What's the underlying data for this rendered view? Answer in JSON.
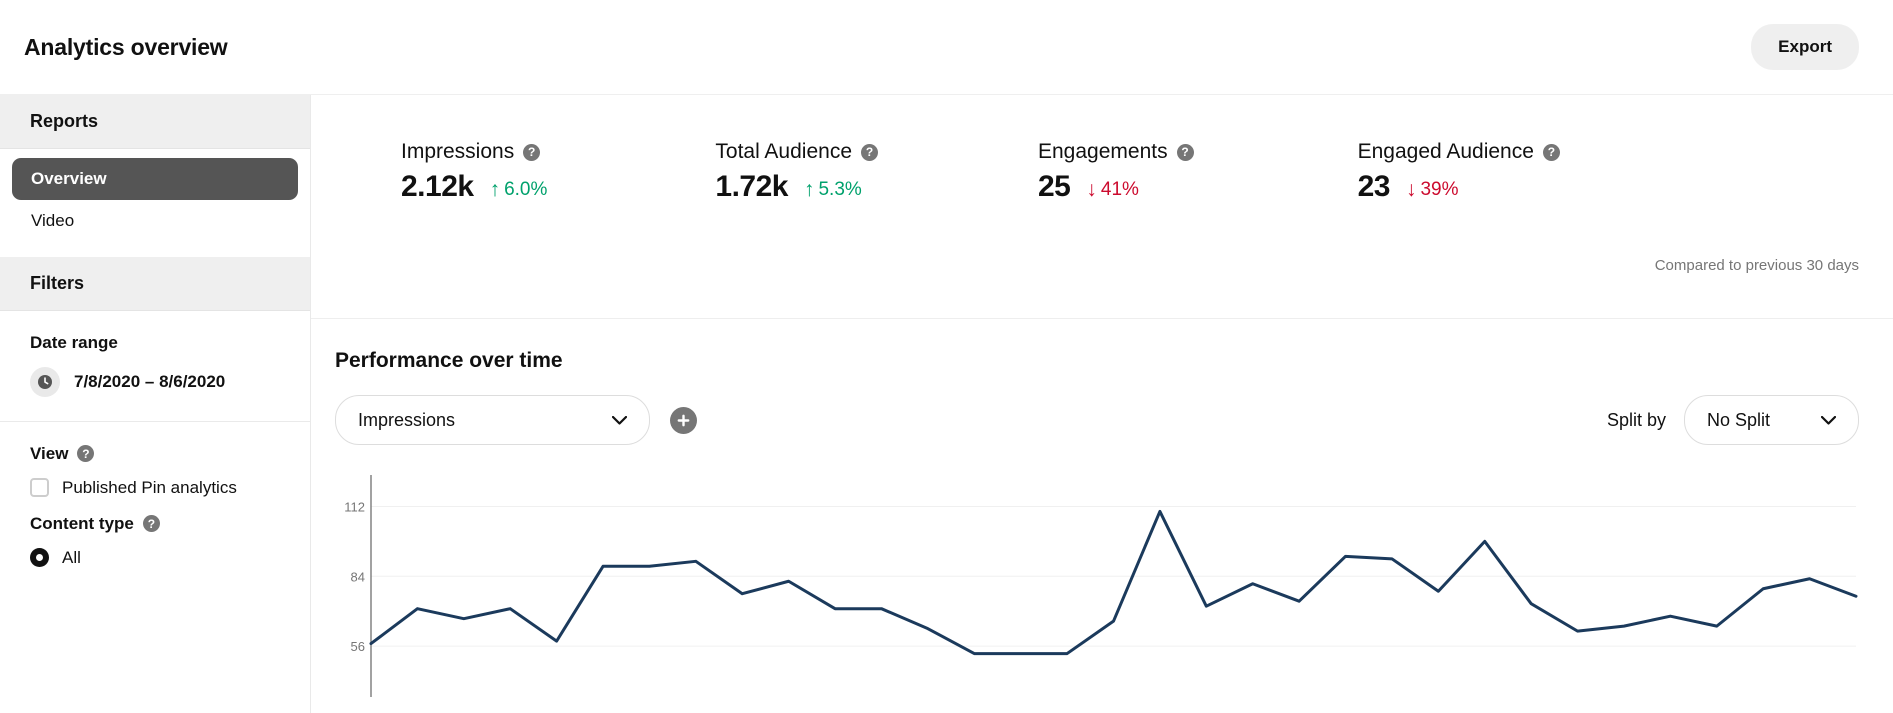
{
  "header": {
    "title": "Analytics overview",
    "export_label": "Export"
  },
  "sidebar": {
    "reports_heading": "Reports",
    "nav_items": [
      {
        "label": "Overview",
        "active": true
      },
      {
        "label": "Video",
        "active": false
      }
    ],
    "filters_heading": "Filters",
    "date_range": {
      "label": "Date range",
      "value": "7/8/2020 – 8/6/2020",
      "icon": "clock-icon"
    },
    "view": {
      "label": "View",
      "help_icon": "help-icon",
      "checkbox_label": "Published Pin analytics",
      "checked": false
    },
    "content_type": {
      "label": "Content type",
      "help_icon": "help-icon",
      "options": [
        {
          "label": "All",
          "selected": true
        }
      ]
    }
  },
  "metrics": {
    "compare_note": "Compared to previous 30 days",
    "items": [
      {
        "name": "Impressions",
        "value": "2.12k",
        "delta": "6.0%",
        "direction": "up",
        "arrow": "↑"
      },
      {
        "name": "Total Audience",
        "value": "1.72k",
        "delta": "5.3%",
        "direction": "up",
        "arrow": "↑"
      },
      {
        "name": "Engagements",
        "value": "25",
        "delta": "41%",
        "direction": "down",
        "arrow": "↓"
      },
      {
        "name": "Engaged Audience",
        "value": "23",
        "delta": "39%",
        "direction": "down",
        "arrow": "↓"
      }
    ],
    "up_color": "#00a16c",
    "down_color": "#cc0b2e"
  },
  "chart_section": {
    "title": "Performance over time",
    "metric_select": {
      "value": "Impressions",
      "chevron": "⌄"
    },
    "add_button": "+",
    "split_by_label": "Split by",
    "split_select": {
      "value": "No Split",
      "chevron": "⌄"
    }
  },
  "chart_data": {
    "type": "line",
    "title": "Performance over time",
    "xlabel": "",
    "ylabel": "Impressions",
    "ylim": [
      42,
      119
    ],
    "yticks": [
      56,
      84,
      112
    ],
    "ytick_labels": [
      "56",
      "84",
      "112"
    ],
    "grid": true,
    "legend": false,
    "line_color": "#1b3a5c",
    "line_width": 3,
    "series": [
      {
        "name": "Impressions",
        "values": [
          57,
          71,
          67,
          71,
          58,
          88,
          88,
          90,
          77,
          82,
          71,
          71,
          63,
          53,
          53,
          53,
          66,
          110,
          72,
          81,
          74,
          92,
          91,
          78,
          98,
          73,
          62,
          64,
          68,
          64,
          79,
          83,
          76
        ]
      }
    ]
  }
}
